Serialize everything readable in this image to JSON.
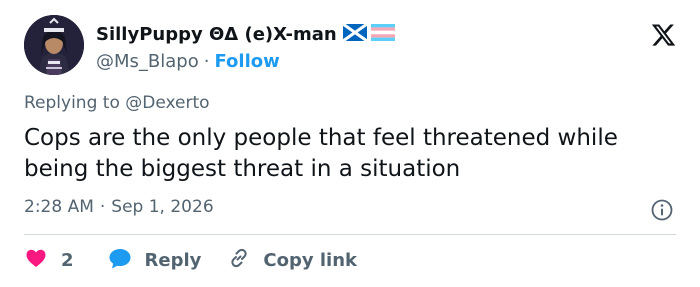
{
  "author": {
    "display_name": "SillyPuppy ΘΔ (e)X-man",
    "handle": "@Ms_Blapo",
    "follow_label": "Follow",
    "separator": "·",
    "flags": [
      "scotland-flag-icon",
      "transgender-flag-icon"
    ]
  },
  "tweet": {
    "replying_prefix": "Replying to",
    "replying_to": "@Dexerto",
    "text": "Cops are the only people that feel threatened while being the biggest threat in a situation",
    "time": "2:28 AM",
    "date": "Sep 1, 2026",
    "meta_separator": "·"
  },
  "actions": {
    "like_count": "2",
    "reply_label": "Reply",
    "copy_label": "Copy link"
  },
  "colors": {
    "accent": "#1d9bf0",
    "like": "#f91880",
    "muted": "#536471",
    "text": "#0f1419",
    "divider": "#cfd9de"
  },
  "icons": [
    "x-logo-icon",
    "info-icon",
    "heart-icon",
    "reply-bubble-icon",
    "link-icon"
  ]
}
